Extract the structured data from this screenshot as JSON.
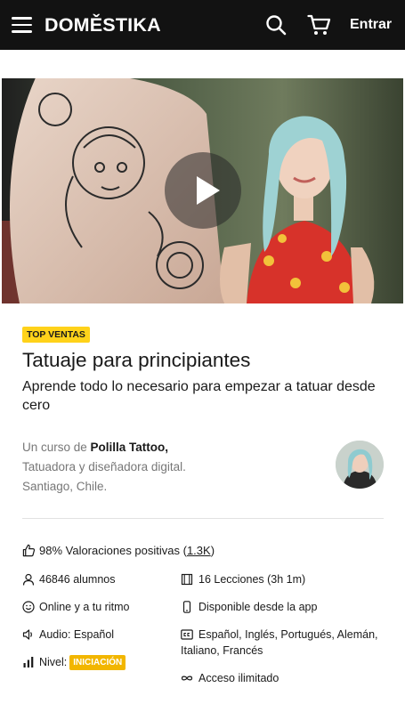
{
  "header": {
    "logo": "DOMĚSTIKA",
    "login_label": "Entrar"
  },
  "course": {
    "badge": "TOP VENTAS",
    "title": "Tatuaje para principiantes",
    "subtitle": "Aprende todo lo necesario para empezar a tatuar desde cero",
    "author_prefix": "Un curso de ",
    "author_name": "Polilla Tattoo,",
    "author_role": "Tatuadora y diseñadora digital.",
    "author_location": "Santiago, Chile."
  },
  "stats": {
    "rating_text": "98% Valoraciones positivas (",
    "rating_count": "1.3K",
    "rating_close": ")",
    "students": "46846 alumnos",
    "lessons": "16 Lecciones (3h 1m)",
    "pace": "Online y a tu ritmo",
    "app": "Disponible desde la app",
    "audio": "Audio: Español",
    "subtitles_line1": "Español, Inglés, Portugués, Alemán,",
    "subtitles_line2": "Italiano, Francés",
    "level_label": "Nivel:",
    "level_value": "INICIACIÓN",
    "access": "Acceso ilimitado"
  },
  "colors": {
    "header_bg": "#121212",
    "badge_yellow": "#ffd21a",
    "level_orange": "#f2b600"
  },
  "icons": [
    "menu-icon",
    "search-icon",
    "cart-icon",
    "play-icon",
    "thumbs-up-icon",
    "user-icon",
    "film-icon",
    "smile-icon",
    "phone-icon",
    "speaker-icon",
    "cc-icon",
    "bars-icon",
    "infinity-icon"
  ]
}
